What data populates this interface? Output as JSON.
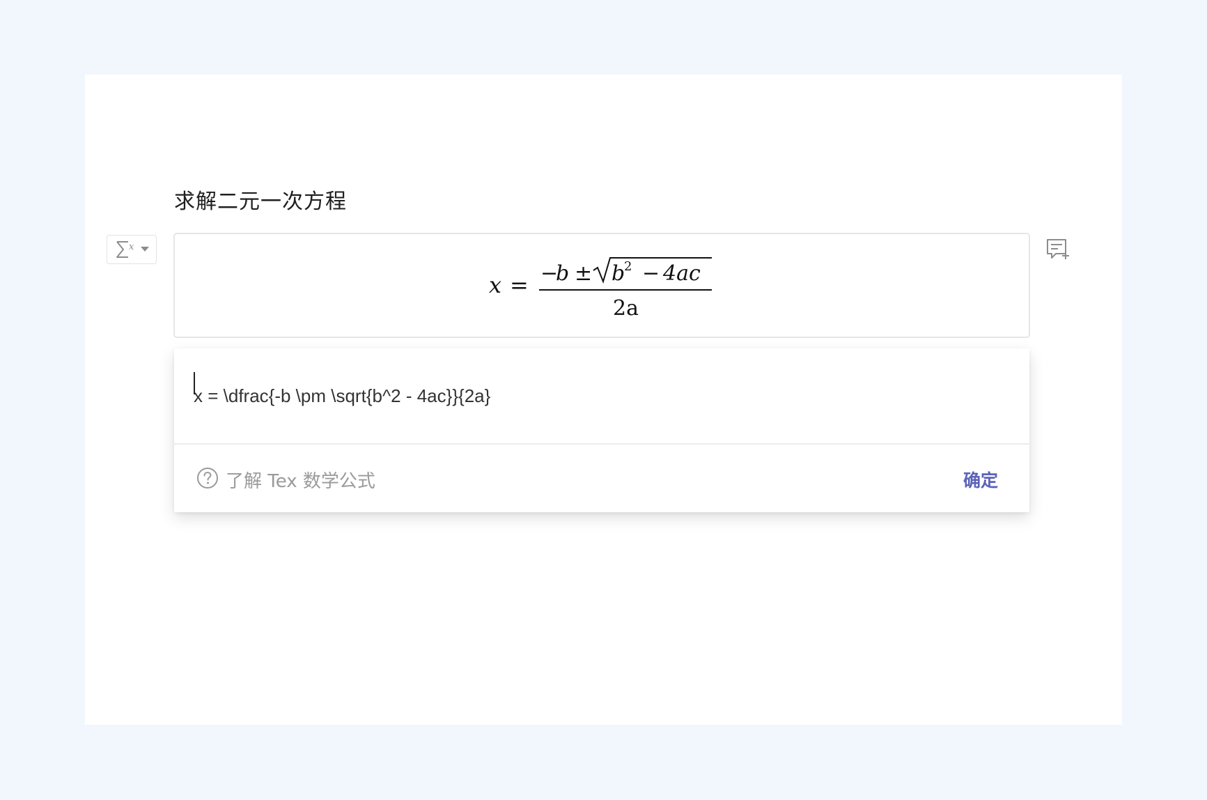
{
  "document": {
    "heading": "求解二元一次方程"
  },
  "formula_block": {
    "type_button_icon": "sigma-x-icon",
    "dropdown_icon": "caret-down-icon",
    "rendered": {
      "lhs": "x",
      "equals": "=",
      "numerator_minus": "−",
      "numerator_b": "b",
      "plus_minus": "±",
      "radicand_b": "b",
      "radicand_exp": "2",
      "radicand_minus": "−",
      "radicand_rest": "4ac",
      "denominator": "2a"
    },
    "comment_icon": "add-comment-icon"
  },
  "editor": {
    "tex_source": "x = \\dfrac{-b \\pm \\sqrt{b^2 - 4ac}}{2a}",
    "help_icon": "question-circle-icon",
    "help_label": "了解 Tex 数学公式",
    "confirm_label": "确定"
  },
  "colors": {
    "background": "#f2f6fd",
    "accent": "#5b63b8",
    "muted_text": "#9a9a9a"
  }
}
